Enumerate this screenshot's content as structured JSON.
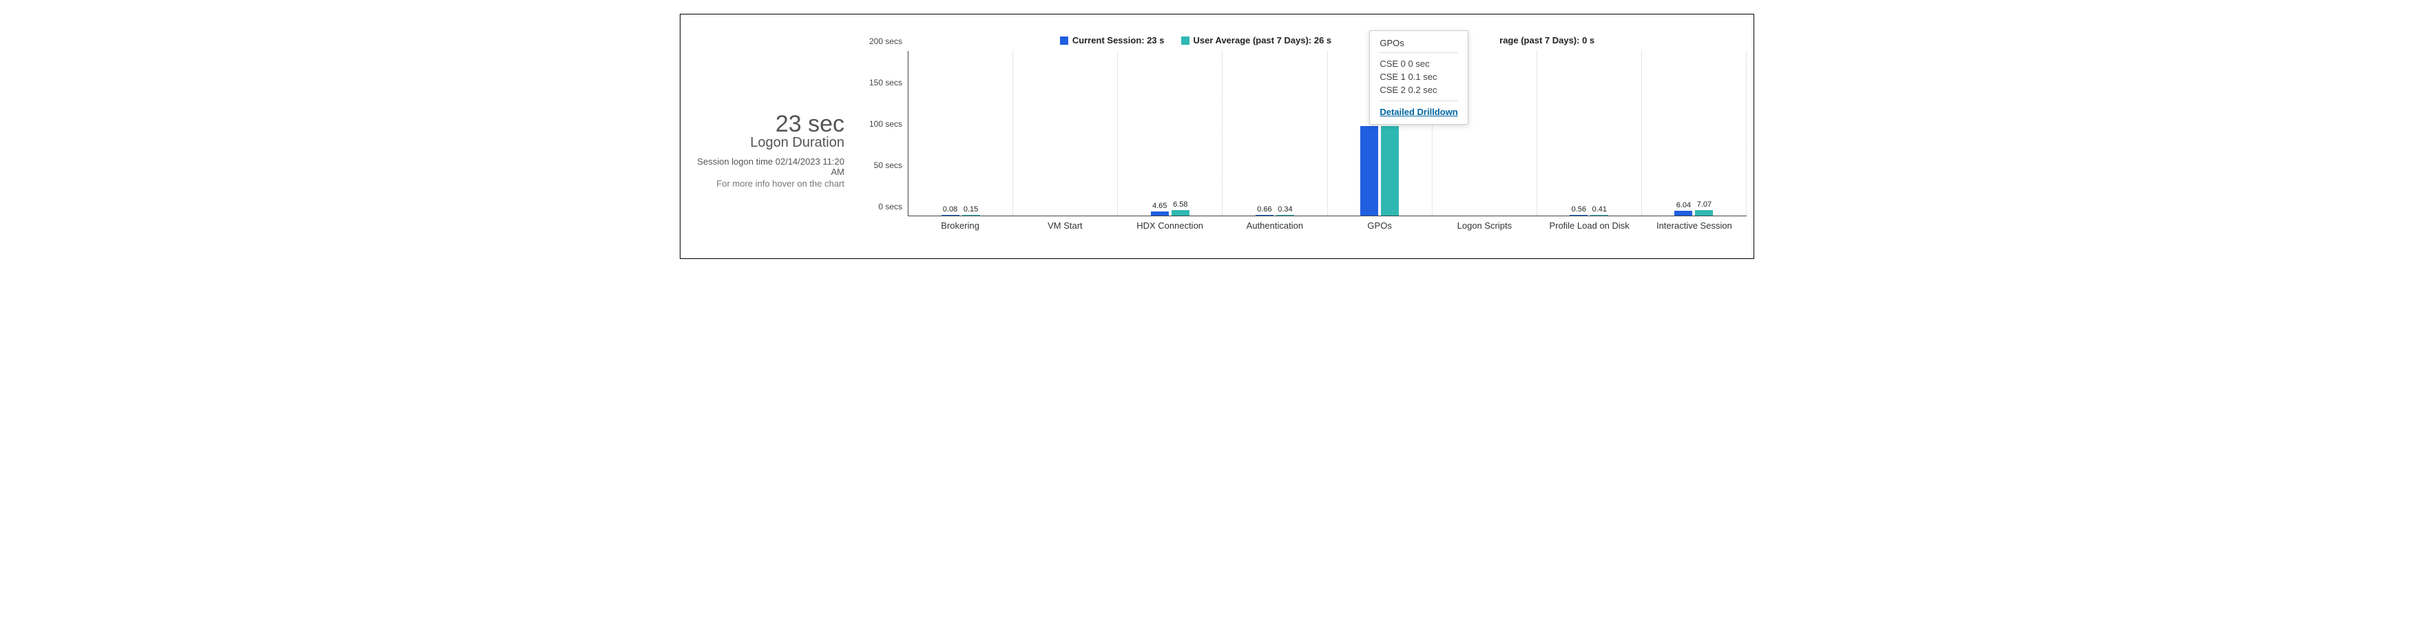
{
  "summary": {
    "value": "23 sec",
    "label": "Logon Duration",
    "session_time_label": "Session logon time 02/14/2023 11:20 AM",
    "hover_hint": "For more info hover on the chart"
  },
  "legend": {
    "current": "Current Session: 23 s",
    "user_avg": "User Average (past 7 Days): 26 s",
    "third_partial": "rage (past 7 Days): 0 s"
  },
  "tooltip": {
    "title": "GPOs",
    "rows": [
      "CSE 0 0 sec",
      "CSE 1 0.1 sec",
      "CSE 2 0.2 sec"
    ],
    "link": "Detailed Drilldown"
  },
  "chart_data": {
    "type": "bar",
    "title": "Logon Duration",
    "ylabel": "secs",
    "ylim": [
      0,
      200
    ],
    "y_ticks": [
      0,
      50,
      100,
      150,
      200
    ],
    "y_tick_labels": [
      "0 secs",
      "50 secs",
      "100 secs",
      "150 secs",
      "200 secs"
    ],
    "categories": [
      "Brokering",
      "VM Start",
      "HDX Connection",
      "Authentication",
      "GPOs",
      "Logon Scripts",
      "Profile Load on Disk",
      "Interactive Session"
    ],
    "series": [
      {
        "name": "Current Session: 23 s",
        "color": "#1f5fe0",
        "values": [
          0.08,
          null,
          4.65,
          0.66,
          null,
          null,
          0.56,
          6.04
        ]
      },
      {
        "name": "User Average (past 7 Days): 26 s",
        "color": "#2fb8b2",
        "values": [
          0.15,
          null,
          6.58,
          0.34,
          null,
          null,
          0.41,
          7.07
        ]
      }
    ],
    "gpo_bars_hidden_behind_tooltip": true
  }
}
